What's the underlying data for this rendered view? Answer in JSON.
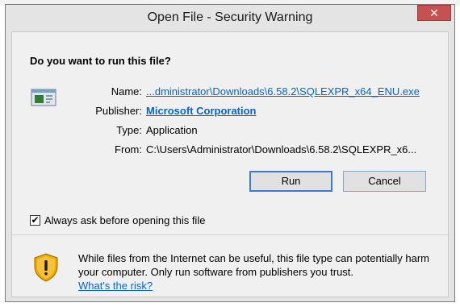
{
  "background": {
    "fragment": "·· ·· ···· ·· ··· ·· ······"
  },
  "dialog": {
    "title": "Open File - Security Warning",
    "close_label": "✕",
    "heading": "Do you want to run this file?",
    "fields": {
      "name_label": "Name:",
      "name_value": "...dministrator\\Downloads\\6.58.2\\SQLEXPR_x64_ENU.exe",
      "publisher_label": "Publisher:",
      "publisher_value": "Microsoft Corporation",
      "type_label": "Type:",
      "type_value": "Application",
      "from_label": "From:",
      "from_value": "C:\\Users\\Administrator\\Downloads\\6.58.2\\SQLEXPR_x6..."
    },
    "buttons": {
      "run": "Run",
      "cancel": "Cancel"
    },
    "checkbox": {
      "label": "Always ask before opening this file",
      "checked": true,
      "mark": "✔"
    },
    "warning": {
      "text": "While files from the Internet can be useful, this file type can potentially harm your computer. Only run software from publishers you trust.",
      "link": "What's the risk?"
    },
    "colors": {
      "link": "#0066cc",
      "close": "#c75050",
      "shield": "#f0a800"
    },
    "icons": {
      "file": "application-file-icon",
      "shield": "warning-shield-icon",
      "close": "close-icon"
    }
  }
}
